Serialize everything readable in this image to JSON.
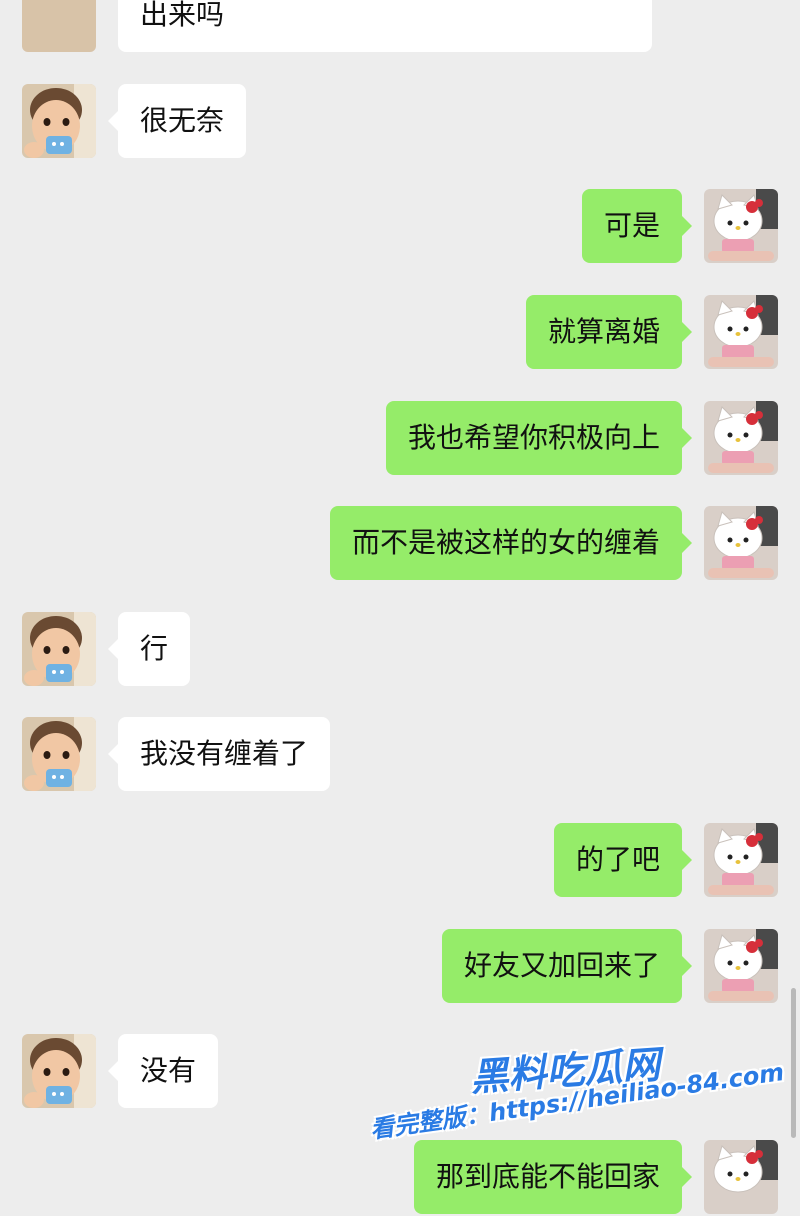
{
  "messages": [
    {
      "side": "left",
      "text": "出来吗"
    },
    {
      "side": "left",
      "text": "很无奈"
    },
    {
      "side": "right",
      "text": "可是"
    },
    {
      "side": "right",
      "text": "就算离婚"
    },
    {
      "side": "right",
      "text": "我也希望你积极向上"
    },
    {
      "side": "right",
      "text": "而不是被这样的女的缠着"
    },
    {
      "side": "left",
      "text": "行"
    },
    {
      "side": "left",
      "text": "我没有缠着了"
    },
    {
      "side": "right",
      "text": "的了吧"
    },
    {
      "side": "right",
      "text": "好友又加回来了"
    },
    {
      "side": "left",
      "text": "没有"
    },
    {
      "side": "right",
      "text": "那到底能不能回家"
    }
  ],
  "watermark": {
    "logo": "黑料吃瓜网",
    "link": "看完整版：https://heiliao-84.com"
  },
  "colors": {
    "background": "#ededed",
    "incoming_bubble": "#ffffff",
    "outgoing_bubble": "#95ec69"
  },
  "icons": {
    "left_avatar": "baby-avatar-icon",
    "right_avatar": "hello-kitty-avatar-icon"
  }
}
